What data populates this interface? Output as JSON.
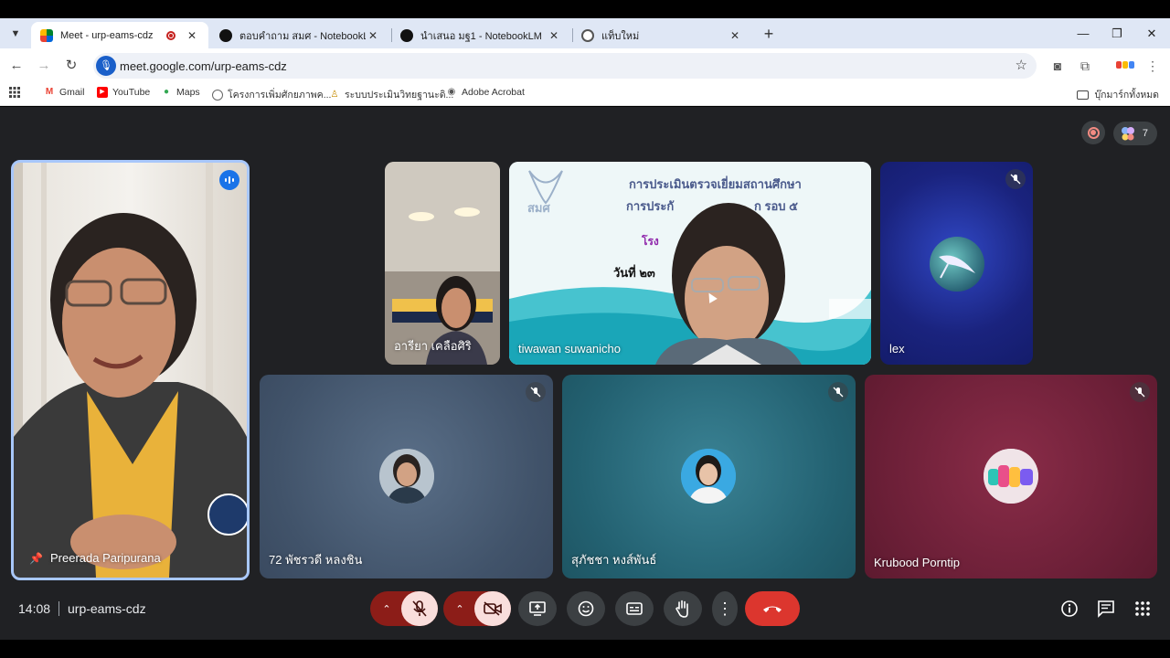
{
  "browser": {
    "tabs": [
      {
        "title": "Meet - urp-eams-cdz",
        "active": true
      },
      {
        "title": "ตอบคำถาม สมศ - NotebookLM",
        "active": false
      },
      {
        "title": "นำเสนอ มฐ1 - NotebookLM",
        "active": false
      },
      {
        "title": "แท็บใหม่",
        "active": false
      }
    ],
    "url": "meet.google.com/urp-eams-cdz",
    "bookmarks": [
      "Gmail",
      "YouTube",
      "Maps",
      "โครงการเพิ่มศักยภาพค...",
      "ระบบประเมินวิทยฐานะดิ...",
      "Adobe Acrobat"
    ],
    "bookmarks_folder": "บุ๊กมาร์กทั้งหมด"
  },
  "meet": {
    "participant_count": "7",
    "participants": [
      {
        "name": "Preerada Paripurana",
        "pinned": true,
        "speaking": true
      },
      {
        "name": "อารียา เคลือศิริ",
        "muted": false
      },
      {
        "name": "tiwawan suwanicho",
        "muted": false
      },
      {
        "name": "lex",
        "muted": true
      },
      {
        "name": "72 พัชรวดี หลงชิน",
        "muted": true
      },
      {
        "name": "สุภัชชา หงส์พันธ์",
        "muted": true
      },
      {
        "name": "Krubood Porntip",
        "muted": true
      }
    ],
    "slide": {
      "logo_text": "สมศ",
      "line1": "การประเมินตรวจเยี่ยมสถานศึกษา",
      "line2": "การประกั",
      "line2_end": "ก รอบ ๕",
      "line3": "โรง",
      "line4": "วันที่ ๒๓"
    },
    "time": "14:08",
    "meeting_code": "urp-eams-cdz"
  }
}
